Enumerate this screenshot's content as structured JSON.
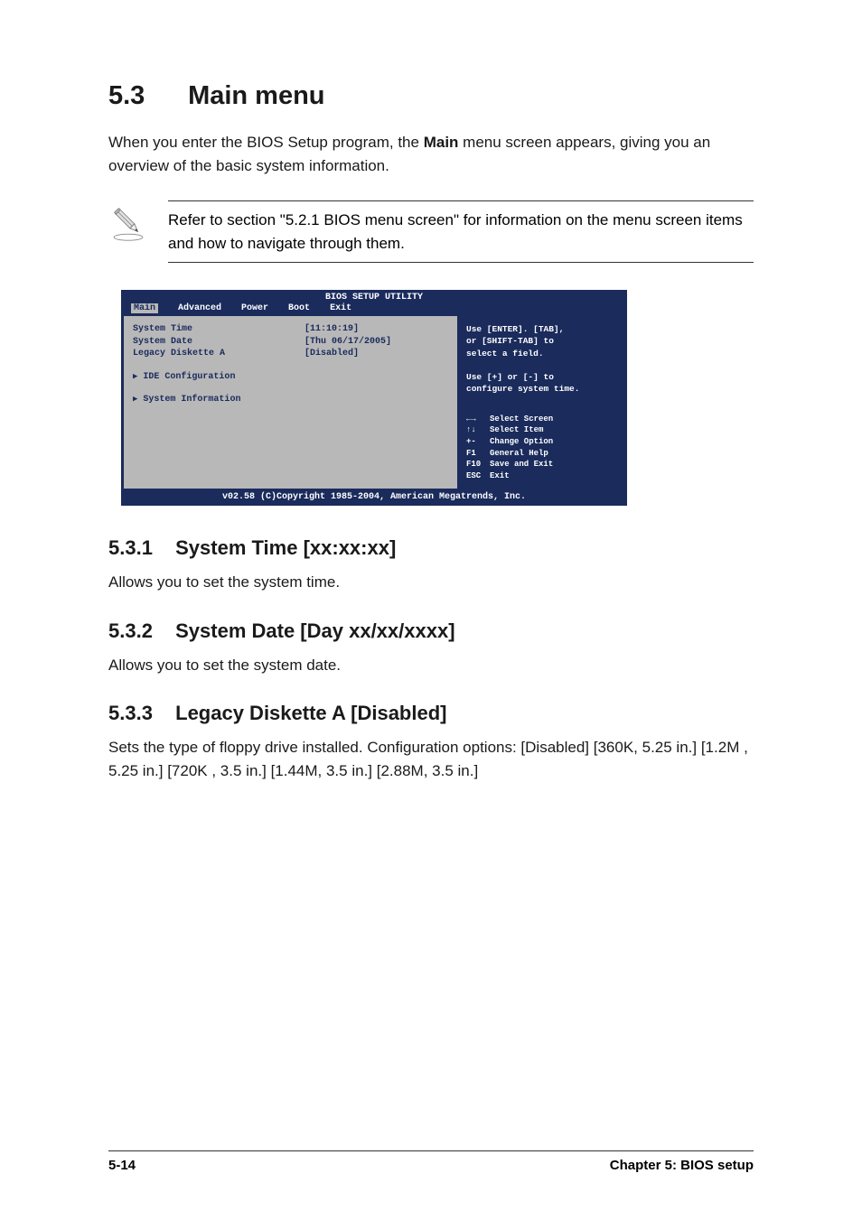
{
  "heading": {
    "number": "5.3",
    "title": "Main menu"
  },
  "intro": {
    "p1_prefix": "When you enter the BIOS Setup program, the ",
    "p1_bold": "Main",
    "p1_suffix": " menu screen appears, giving you an overview of the basic system information."
  },
  "note": "Refer to section \"5.2.1  BIOS menu screen\" for information on the menu screen items and how to navigate through them.",
  "bios": {
    "title": "BIOS SETUP UTILITY",
    "menus": [
      "Main",
      "Advanced",
      "Power",
      "Boot",
      "Exit"
    ],
    "rows": [
      {
        "label": "System Time",
        "value": "[11:10:19]"
      },
      {
        "label": "System Date",
        "value": "[Thu 06/17/2005]"
      },
      {
        "label": "Legacy Diskette A",
        "value": "[Disabled]"
      }
    ],
    "subs": [
      "IDE Configuration",
      "System Information"
    ],
    "help_top": [
      "Use [ENTER]. [TAB],",
      "or [SHIFT-TAB] to",
      "select a field.",
      "",
      "Use [+] or [-] to",
      "configure system time."
    ],
    "help_bottom": [
      {
        "key": "←→",
        "text": "Select Screen"
      },
      {
        "key": "↑↓",
        "text": "Select Item"
      },
      {
        "key": "+-",
        "text": "Change Option"
      },
      {
        "key": "F1",
        "text": "General Help"
      },
      {
        "key": "F10",
        "text": "Save and Exit"
      },
      {
        "key": "ESC",
        "text": "Exit"
      }
    ],
    "footer": "v02.58 (C)Copyright 1985-2004, American Megatrends, Inc."
  },
  "sections": [
    {
      "num": "5.3.1",
      "title": "System Time [xx:xx:xx]",
      "body": "Allows you to set the system time."
    },
    {
      "num": "5.3.2",
      "title": "System Date [Day xx/xx/xxxx]",
      "body": "Allows you to set the system date."
    },
    {
      "num": "5.3.3",
      "title": "Legacy Diskette A [Disabled]",
      "body": "Sets the type of floppy drive installed. Configuration options: [Disabled] [360K, 5.25 in.] [1.2M , 5.25 in.] [720K , 3.5 in.] [1.44M, 3.5 in.] [2.88M, 3.5 in.]"
    }
  ],
  "footer": {
    "left": "5-14",
    "right": "Chapter 5: BIOS setup"
  }
}
